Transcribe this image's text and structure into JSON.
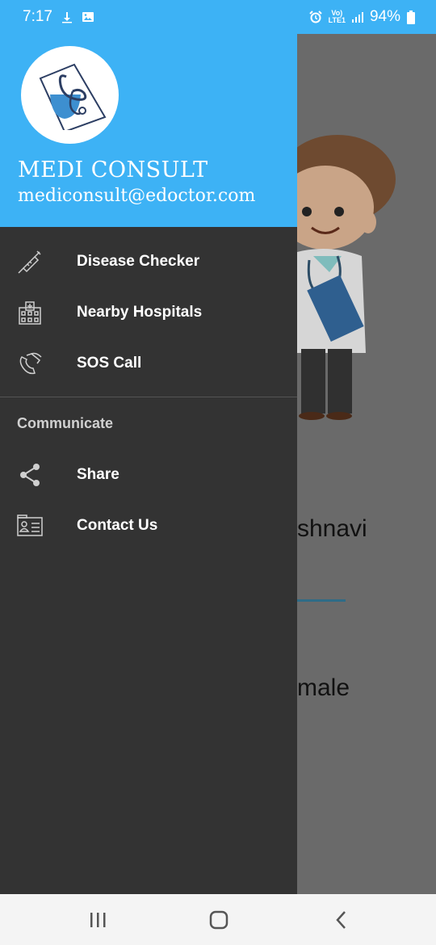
{
  "status_bar": {
    "time": "7:17",
    "battery": "94%",
    "network_label": "LTE1",
    "volte_label": "Vo)",
    "icons": [
      "download-icon",
      "image-icon",
      "alarm-icon",
      "signal-icon",
      "battery-icon"
    ]
  },
  "drawer": {
    "app_name": "MEDI CONSULT",
    "email": "mediconsult@edoctor.com",
    "items": [
      {
        "label": "Disease Checker",
        "icon": "syringe-icon"
      },
      {
        "label": "Nearby Hospitals",
        "icon": "hospital-icon"
      },
      {
        "label": "SOS Call",
        "icon": "phone-icon"
      }
    ],
    "section_title": "Communicate",
    "section_items": [
      {
        "label": "Share",
        "icon": "share-icon"
      },
      {
        "label": "Contact Us",
        "icon": "contact-card-icon"
      }
    ]
  },
  "background": {
    "name_fragment": "shnavi",
    "gender_fragment": "male"
  },
  "colors": {
    "accent": "#3db2f5",
    "drawer_bg": "#333333",
    "nav_bg": "#f4f4f4"
  }
}
